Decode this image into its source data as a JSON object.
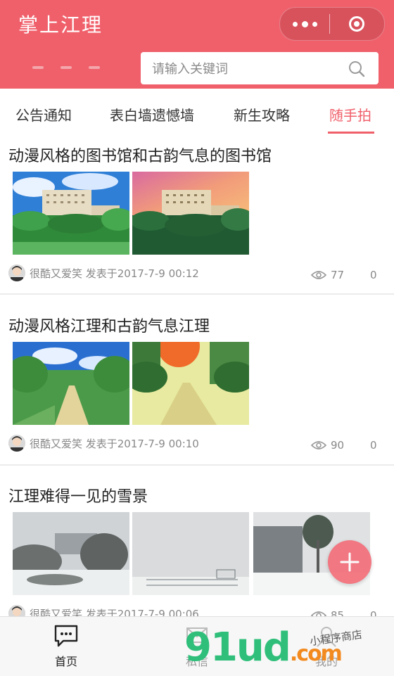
{
  "header": {
    "title": "掌上江理",
    "search_placeholder": "请输入关键词"
  },
  "tabs": [
    {
      "label": "公告通知"
    },
    {
      "label": "表白墙遗憾墙"
    },
    {
      "label": "新生攻略"
    },
    {
      "label": "随手拍"
    }
  ],
  "active_tab_index": 3,
  "posts": [
    {
      "title": "动漫风格的图书馆和古韵气息的图书馆",
      "author_line": "很酷又爱笑 发表于2017-7-9 00:12",
      "views": "77",
      "comments": "0"
    },
    {
      "title": "动漫风格江理和古韵气息江理",
      "author_line": "很酷又爱笑 发表于2017-7-9 00:10",
      "views": "90",
      "comments": "0"
    },
    {
      "title": "江理难得一见的雪景",
      "author_line": "很酷又爱笑 发表于2017-7-9 00:06",
      "views": "85",
      "comments": "0"
    }
  ],
  "bottom_nav": [
    {
      "label": "首页"
    },
    {
      "label": "私信"
    },
    {
      "label": "我的"
    }
  ],
  "watermark": {
    "brand": "91ud",
    "suffix": ".com",
    "shop": "小程序商店"
  },
  "colors": {
    "accent": "#f0606b",
    "fab": "#f36f7a"
  }
}
